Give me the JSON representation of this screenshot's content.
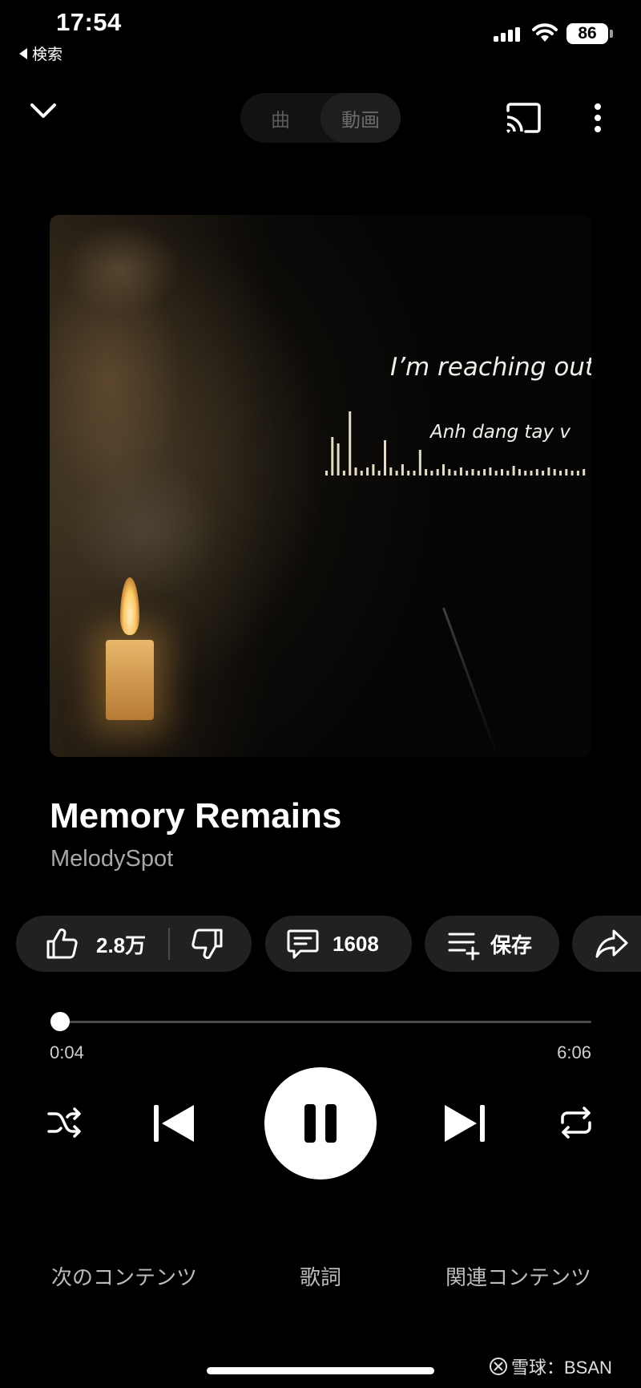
{
  "status_bar": {
    "time": "17:54",
    "back_label": "検索",
    "battery": "86"
  },
  "header": {
    "tabs": [
      {
        "label": "曲",
        "active": false
      },
      {
        "label": "動画",
        "active": true
      }
    ]
  },
  "artwork": {
    "lyric_line_1": "I’m reaching out",
    "lyric_line_2": "Anh dang tay v"
  },
  "track": {
    "title": "Memory Remains",
    "artist": "MelodySpot"
  },
  "actions": {
    "likes": "2.8万",
    "comments": "1608",
    "save_label": "保存",
    "share_label": "共有"
  },
  "progress": {
    "current": "0:04",
    "total": "6:06",
    "fraction": 0.011
  },
  "bottom_tabs": {
    "next": "次のコンテンツ",
    "lyrics": "歌詞",
    "related": "関連コンテンツ"
  },
  "watermark": {
    "text": "雪球：BSAN"
  },
  "icons": {
    "collapse": "chevron-down-icon",
    "cast": "cast-icon",
    "more": "more-vertical-icon",
    "like": "thumbs-up-icon",
    "dislike": "thumbs-down-icon",
    "comment": "comment-icon",
    "save": "playlist-add-icon",
    "share": "share-icon",
    "shuffle": "shuffle-icon",
    "previous": "skip-previous-icon",
    "pause": "pause-icon",
    "next": "skip-next-icon",
    "repeat": "repeat-icon"
  },
  "colors": {
    "background": "#000000",
    "chip": "#212121",
    "secondary_text": "#a8a8a8"
  }
}
